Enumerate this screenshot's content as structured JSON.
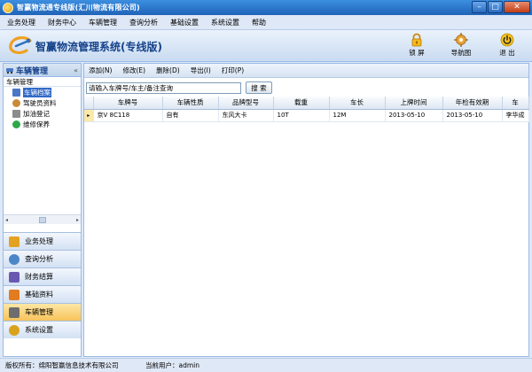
{
  "window": {
    "title": "智赢物流通专线版(汇川物流有限公司)",
    "controls": [
      "–",
      "□",
      "✕"
    ]
  },
  "menu": [
    "业务处理",
    "财务中心",
    "车辆管理",
    "查询分析",
    "基础设置",
    "系统设置",
    "帮助"
  ],
  "header": {
    "brand": "智赢物流管理系统(专线版)",
    "buttons": [
      {
        "label": "锁 屏",
        "icon": "lock-icon"
      },
      {
        "label": "导航图",
        "icon": "navigation-map-icon"
      },
      {
        "label": "退 出",
        "icon": "power-icon"
      }
    ]
  },
  "sidebar": {
    "title": "车辆管理",
    "collapse": "«",
    "subtitle": "车辆管理",
    "items": [
      {
        "label": "车辆档案",
        "selected": true,
        "color": "#4a78c6"
      },
      {
        "label": "驾驶员资料",
        "selected": false,
        "color": "#c98b3a"
      },
      {
        "label": "加油登记",
        "selected": false,
        "color": "#8c8c8c"
      },
      {
        "label": "维修保养",
        "selected": false,
        "color": "#2ea84a"
      }
    ],
    "scroll_left": "◂",
    "scroll_right": "▸",
    "nav": [
      {
        "label": "业务处理",
        "active": false,
        "color": "#e3a21f"
      },
      {
        "label": "查询分析",
        "active": false,
        "color": "#4b86c8"
      },
      {
        "label": "财务结算",
        "active": false,
        "color": "#6a58b0"
      },
      {
        "label": "基础资料",
        "active": false,
        "color": "#e37b1f"
      },
      {
        "label": "车辆管理",
        "active": true,
        "color": "#6d6d6d"
      },
      {
        "label": "系统设置",
        "active": false,
        "color": "#d9a21c"
      }
    ]
  },
  "toolbar": [
    "添加(N)",
    "修改(E)",
    "删除(D)",
    "导出(I)",
    "打印(P)"
  ],
  "search": {
    "value": "请输入车牌号/车主/备注查询",
    "button": "搜 索"
  },
  "table": {
    "columns": [
      "",
      "车牌号",
      "车辆性质",
      "品牌型号",
      "载重",
      "车长",
      "上牌时间",
      "年检有效期",
      "车"
    ],
    "rows": [
      {
        "indicator": "▸",
        "cells": [
          "京V 8C118",
          "自有",
          "东风大卡",
          "10T",
          "12M",
          "2013-05-10",
          "2013-05-10",
          "李华成"
        ]
      }
    ]
  },
  "status": {
    "copyright": "版权所有：绵阳智赢信息技术有限公司",
    "user": "当前用户：admin"
  }
}
